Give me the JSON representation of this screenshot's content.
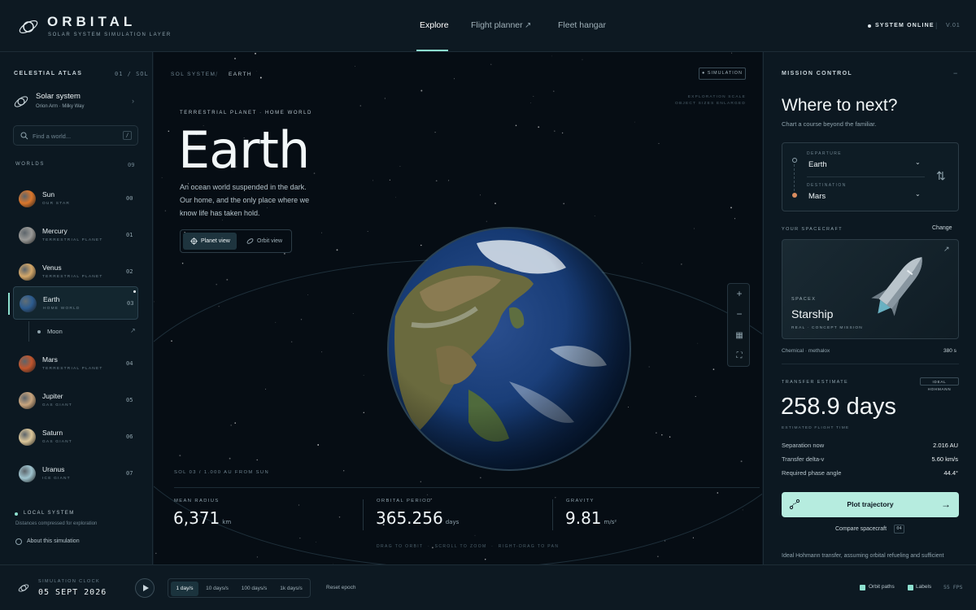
{
  "app": {
    "brand": "ORBITAL",
    "brand_sub": "SOLAR SYSTEM SIMULATION LAYER",
    "nav": [
      {
        "label": "Explore"
      },
      {
        "label": "Flight planner"
      },
      {
        "label": "Fleet hangar"
      }
    ],
    "status": "SYSTEM ONLINE",
    "version": "V.01"
  },
  "atlas": {
    "title": "CELESTIAL ATLAS",
    "count": "01 / SOL",
    "system_name": "Solar system",
    "system_sub": "Orion Arm · Milky Way",
    "search_placeholder": "Find a world...",
    "search_key": "/",
    "worlds_label": "WORLDS",
    "worlds_count": "09",
    "worlds": [
      {
        "name": "Sun",
        "sub": "OUR STAR",
        "num": "00",
        "color": "#d9762c"
      },
      {
        "name": "Mercury",
        "sub": "TERRESTRIAL PLANET",
        "num": "01",
        "color": "#9a9a98"
      },
      {
        "name": "Venus",
        "sub": "TERRESTRIAL PLANET",
        "num": "02",
        "color": "#d4a86a"
      },
      {
        "name": "Earth",
        "sub": "HOME WORLD",
        "num": "03",
        "color": "#2d5c8f"
      },
      {
        "name": "Mars",
        "sub": "TERRESTRIAL PLANET",
        "num": "04",
        "color": "#c0562e"
      },
      {
        "name": "Jupiter",
        "sub": "GAS GIANT",
        "num": "05",
        "color": "#c9a57e"
      },
      {
        "name": "Saturn",
        "sub": "GAS GIANT",
        "num": "06",
        "color": "#dcc79a"
      },
      {
        "name": "Uranus",
        "sub": "ICE GIANT",
        "num": "07",
        "color": "#9fc4cf"
      }
    ],
    "moon": "Moon",
    "local_label": "LOCAL SYSTEM",
    "local_sub": "Distances compressed for exploration",
    "about": "About this simulation"
  },
  "view": {
    "crumb_system": "SOL SYSTEM",
    "crumb_current": "EARTH",
    "mode_badge": "SIMULATION",
    "scale_label": "EXPLORATION SCALE\nOBJECT SIZES ENLARGED",
    "kicker": "TERRESTRIAL PLANET · HOME WORLD",
    "title": "Earth",
    "description": "An ocean world suspended in the dark. Our home, and the only place where we know life has taken hold.",
    "toggle_planet": "Planet view",
    "toggle_orbit": "Orbit view",
    "distance": "SOL 03 / 1.000 AU FROM SUN",
    "stats": [
      {
        "label": "MEAN RADIUS",
        "value": "6,371",
        "unit": "km"
      },
      {
        "label": "ORBITAL PERIOD",
        "value": "365.256",
        "unit": "days"
      },
      {
        "label": "GRAVITY",
        "value": "9.81",
        "unit": "m/s²"
      }
    ],
    "hints": "DRAG TO ORBIT  ·  SCROLL TO ZOOM  ·  RIGHT-DRAG TO PAN"
  },
  "mission": {
    "title": "MISSION CONTROL",
    "heading": "Where to next?",
    "subheading": "Chart a course beyond the familiar.",
    "departure_label": "DEPARTURE",
    "departure": "Earth",
    "destination_label": "DESTINATION",
    "destination": "Mars",
    "spacecraft_label": "YOUR SPACECRAFT",
    "change": "Change",
    "craft_brand": "SPACEX",
    "craft_name": "Starship",
    "craft_sub": "REAL · CONCEPT MISSION",
    "fuel": "Chemical · methalox",
    "fuel_value": "380 s",
    "estimate_label": "TRANSFER ESTIMATE",
    "estimate_badge": "IDEAL HOHMANN",
    "estimate_value": "258.9 days",
    "estimate_sub": "ESTIMATED FLIGHT TIME",
    "metrics": [
      {
        "k": "Separation now",
        "v": "2.016 AU"
      },
      {
        "k": "Transfer delta-v",
        "v": "5.60 km/s"
      },
      {
        "k": "Required phase angle",
        "v": "44.4°"
      }
    ],
    "plot_button": "Plot trajectory",
    "compare": "Compare spacecraft",
    "compare_count": "04",
    "footnote": "Ideal Hohmann transfer, assuming orbital refueling and sufficient"
  },
  "clock": {
    "label": "SIMULATION CLOCK",
    "date": "05 SEPT 2026",
    "speeds": [
      "1 day/s",
      "10 days/s",
      "100 days/s",
      "1k days/s"
    ],
    "selected_speed": "1 day/s",
    "reset": "Reset epoch",
    "orbit_paths": "Orbit paths",
    "labels": "Labels",
    "fps": "55 FPS"
  },
  "colors": {
    "accent": "#8de0cf",
    "cta": "#b6ecdf",
    "background": "#0b1620"
  }
}
